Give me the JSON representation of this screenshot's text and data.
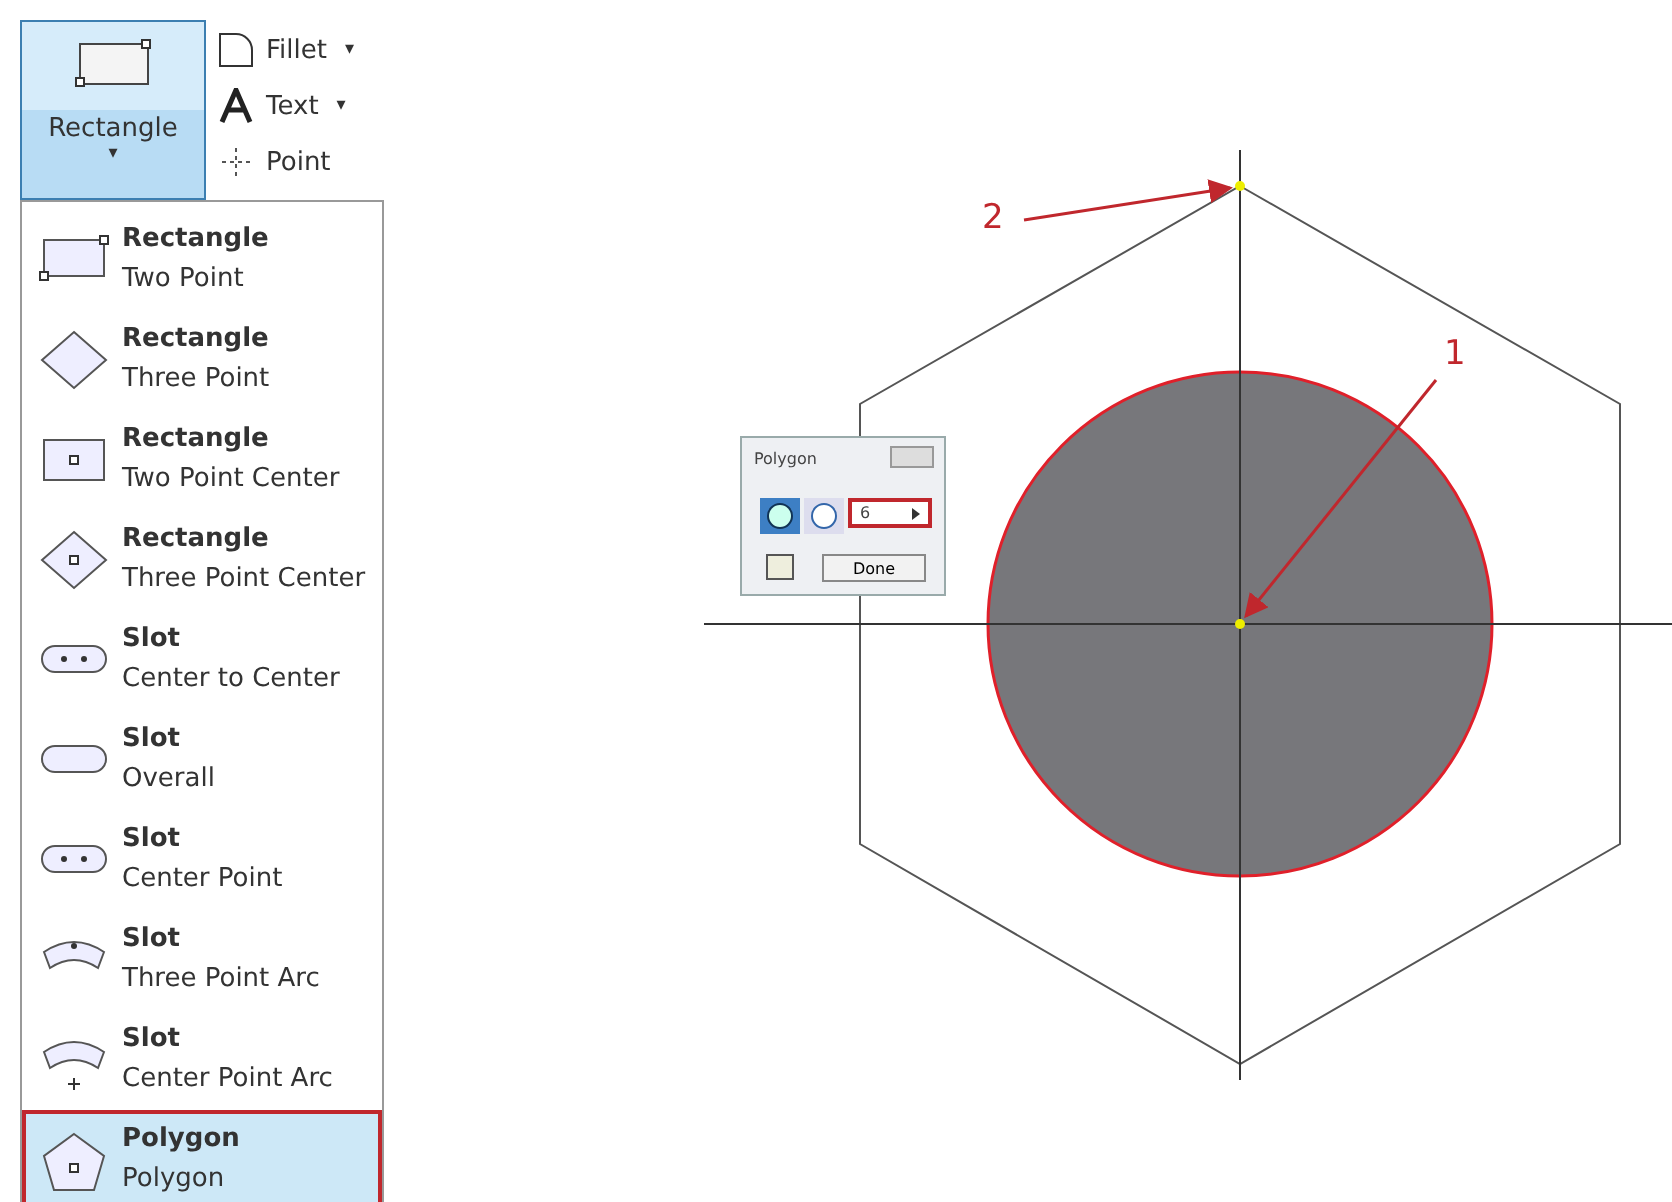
{
  "ribbon": {
    "main_button": {
      "label": "Rectangle",
      "caret": "▾",
      "selected": true
    },
    "tools": [
      {
        "kind": "fillet",
        "label": "Fillet",
        "caret": "▾"
      },
      {
        "kind": "text",
        "label": "Text",
        "caret": "▾"
      },
      {
        "kind": "point",
        "label": "Point"
      }
    ]
  },
  "menu": {
    "items": [
      {
        "kind": "rect-two-point",
        "title": "Rectangle",
        "subtitle": "Two Point",
        "selected": false
      },
      {
        "kind": "rect-three-point",
        "title": "Rectangle",
        "subtitle": "Three Point",
        "selected": false
      },
      {
        "kind": "rect-two-point-center",
        "title": "Rectangle",
        "subtitle": "Two Point Center",
        "selected": false
      },
      {
        "kind": "rect-three-point-center",
        "title": "Rectangle",
        "subtitle": "Three Point Center",
        "selected": false
      },
      {
        "kind": "slot-center",
        "title": "Slot",
        "subtitle": "Center to Center",
        "selected": false
      },
      {
        "kind": "slot-overall",
        "title": "Slot",
        "subtitle": "Overall",
        "selected": false
      },
      {
        "kind": "slot-center",
        "title": "Slot",
        "subtitle": "Center Point",
        "selected": false
      },
      {
        "kind": "slot-arc",
        "title": "Slot",
        "subtitle": "Three Point Arc",
        "selected": false
      },
      {
        "kind": "slot-arc-center",
        "title": "Slot",
        "subtitle": "Center Point Arc",
        "selected": false
      },
      {
        "kind": "polygon",
        "title": "Polygon",
        "subtitle": "Polygon",
        "selected": true
      }
    ]
  },
  "dialog": {
    "title": "Polygon",
    "value": "6",
    "button": "Done"
  },
  "callouts": [
    {
      "label": "1"
    },
    {
      "label": "2"
    }
  ]
}
